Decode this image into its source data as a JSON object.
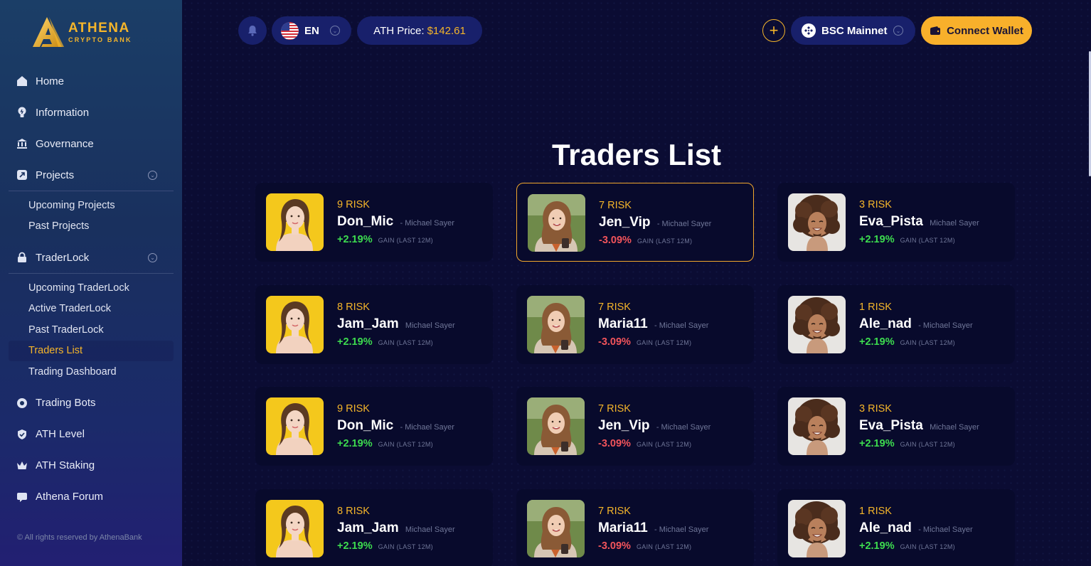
{
  "brand": {
    "title": "ATHENA",
    "subtitle": "CRYPTO BANK"
  },
  "sidebar": {
    "items": [
      {
        "key": "home",
        "label": "Home",
        "icon": "home-icon"
      },
      {
        "key": "information",
        "label": "Information",
        "icon": "bulb-icon"
      },
      {
        "key": "governance",
        "label": "Governance",
        "icon": "bank-icon"
      },
      {
        "key": "projects",
        "label": "Projects",
        "icon": "rocket-icon",
        "expandable": true,
        "children": [
          "Upcoming Projects",
          "Past Projects"
        ]
      },
      {
        "key": "traderlock",
        "label": "TraderLock",
        "icon": "lock-icon",
        "expandable": true,
        "children": [
          "Upcoming TraderLock",
          "Active TraderLock",
          "Past TraderLock",
          "Traders List",
          "Trading Dashboard"
        ]
      },
      {
        "key": "trading-bots",
        "label": "Trading Bots",
        "icon": "bot-icon"
      },
      {
        "key": "ath-level",
        "label": "ATH Level",
        "icon": "shield-icon"
      },
      {
        "key": "ath-staking",
        "label": "ATH Staking",
        "icon": "crown-icon"
      },
      {
        "key": "athena-forum",
        "label": "Athena Forum",
        "icon": "chat-icon"
      }
    ],
    "active_subitem": "Traders List",
    "copyright": "© All rights reserved by AthenaBank"
  },
  "header": {
    "language": "EN",
    "price_label": "ATH Price:",
    "price_value": "$142.61",
    "network": "BSC Mainnet",
    "connect_label": "Connect Wallet"
  },
  "page": {
    "title": "Traders List"
  },
  "traders": [
    {
      "risk": "9 RISK",
      "name": "Don_Mic",
      "by": "- Michael Sayer",
      "gain": "+2.19%",
      "gain_label": "GAIN (LAST 12M)",
      "avatar": "yellow"
    },
    {
      "risk": "7 RISK",
      "name": "Jen_Vip",
      "by": "- Michael Sayer",
      "gain": "-3.09%",
      "gain_label": "GAIN (LAST 12M)",
      "avatar": "green"
    },
    {
      "risk": "3 RISK",
      "name": "Eva_Pista",
      "by": "Michael Sayer",
      "gain": "+2.19%",
      "gain_label": "GAIN (LAST 12M)",
      "avatar": "curly"
    },
    {
      "risk": "8 RISK",
      "name": "Jam_Jam",
      "by": "Michael Sayer",
      "gain": "+2.19%",
      "gain_label": "GAIN (LAST 12M)",
      "avatar": "yellow"
    },
    {
      "risk": "7 RISK",
      "name": "Maria11",
      "by": "- Michael Sayer",
      "gain": "-3.09%",
      "gain_label": "GAIN (LAST 12M)",
      "avatar": "green"
    },
    {
      "risk": "1 RISK",
      "name": "Ale_nad",
      "by": "- Michael Sayer",
      "gain": "+2.19%",
      "gain_label": "GAIN (LAST 12M)",
      "avatar": "curly"
    },
    {
      "risk": "9 RISK",
      "name": "Don_Mic",
      "by": "- Michael Sayer",
      "gain": "+2.19%",
      "gain_label": "GAIN (LAST 12M)",
      "avatar": "yellow"
    },
    {
      "risk": "7 RISK",
      "name": "Jen_Vip",
      "by": "- Michael Sayer",
      "gain": "-3.09%",
      "gain_label": "GAIN (LAST 12M)",
      "avatar": "green"
    },
    {
      "risk": "3 RISK",
      "name": "Eva_Pista",
      "by": "Michael Sayer",
      "gain": "+2.19%",
      "gain_label": "GAIN (LAST 12M)",
      "avatar": "curly"
    },
    {
      "risk": "8 RISK",
      "name": "Jam_Jam",
      "by": "Michael Sayer",
      "gain": "+2.19%",
      "gain_label": "GAIN (LAST 12M)",
      "avatar": "yellow"
    },
    {
      "risk": "7 RISK",
      "name": "Maria11",
      "by": "- Michael Sayer",
      "gain": "-3.09%",
      "gain_label": "GAIN (LAST 12M)",
      "avatar": "green"
    },
    {
      "risk": "1 RISK",
      "name": "Ale_nad",
      "by": "- Michael Sayer",
      "gain": "+2.19%",
      "gain_label": "GAIN (LAST 12M)",
      "avatar": "curly"
    }
  ],
  "selected_trader_index": 1,
  "colors": {
    "accent": "#f5b52a",
    "positive": "#3ddc4f",
    "negative": "#f2545b",
    "background": "#0b0c33"
  }
}
